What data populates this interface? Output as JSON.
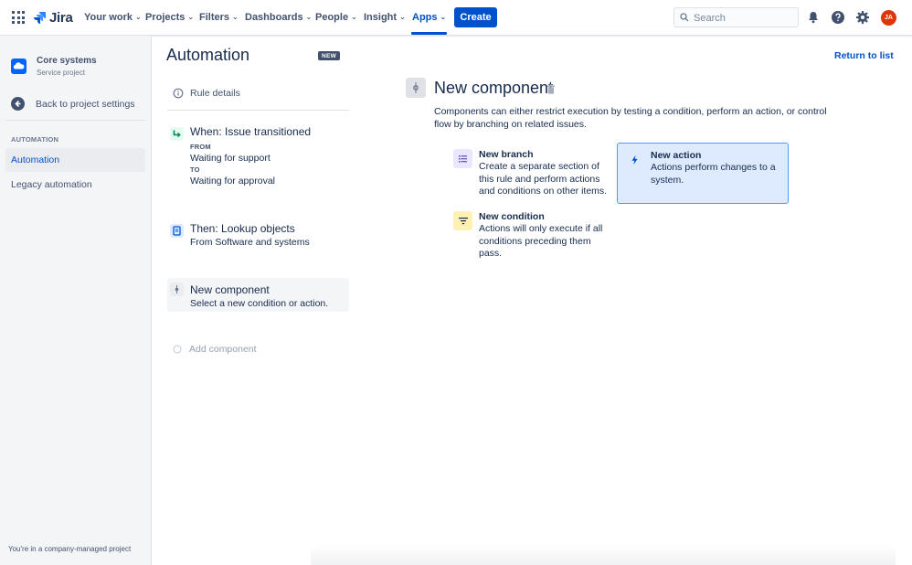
{
  "topnav": {
    "logo_text": "Jira",
    "items": [
      {
        "label": "Your work"
      },
      {
        "label": "Projects"
      },
      {
        "label": "Filters"
      },
      {
        "label": "Dashboards"
      },
      {
        "label": "People"
      },
      {
        "label": "Insight"
      },
      {
        "label": "Apps"
      }
    ],
    "active_item": "Apps",
    "create_label": "Create",
    "search_placeholder": "Search",
    "avatar_initials": "JA",
    "avatar_color": "#de350b",
    "accent_color": "#0052cc"
  },
  "sidebar": {
    "project_name": "Core systems",
    "project_type": "Service project",
    "back_label": "Back to project settings",
    "section_heading": "AUTOMATION",
    "items": [
      {
        "label": "Automation",
        "selected": true
      },
      {
        "label": "Legacy automation",
        "selected": false
      }
    ],
    "footer": "You're in a company-managed project"
  },
  "main": {
    "title": "Automation",
    "title_badge": "NEW",
    "return_label": "Return to list",
    "rule_details_label": "Rule details",
    "components": {
      "trigger": {
        "title": "When: Issue transitioned",
        "from_label": "FROM",
        "from_value": "Waiting for support",
        "to_label": "TO",
        "to_value": "Waiting for approval"
      },
      "lookup": {
        "title": "Then: Lookup objects",
        "detail": "From Software and systems"
      },
      "new_component": {
        "title": "New component",
        "detail": "Select a new condition or action."
      }
    },
    "add_component_label": "Add component"
  },
  "panel": {
    "title": "New component",
    "description": "Components can either restrict execution by testing a condition, perform an action, or control flow by branching on related issues.",
    "options": {
      "branch": {
        "title": "New branch",
        "description": "Create a separate section of this rule and perform actions and conditions on other items."
      },
      "action": {
        "title": "New action",
        "description": "Actions perform changes to a system."
      },
      "condition": {
        "title": "New condition",
        "description": "Actions will only execute if all conditions preceding them pass."
      }
    }
  }
}
